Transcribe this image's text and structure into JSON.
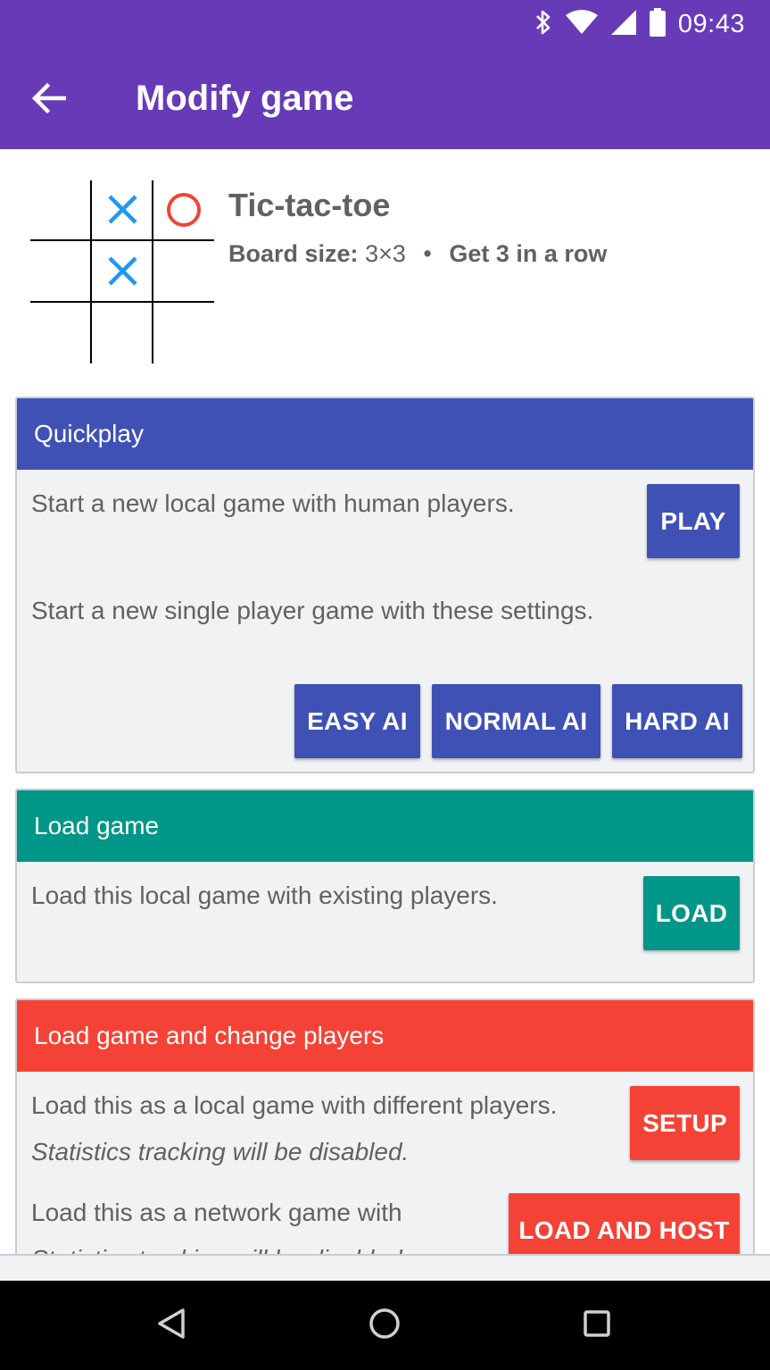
{
  "status_bar": {
    "time": "09:43",
    "icons": [
      "bluetooth-icon",
      "wifi-icon",
      "signal-icon",
      "battery-icon"
    ]
  },
  "app_bar": {
    "title": "Modify game",
    "back_icon": "arrow-back-icon"
  },
  "game": {
    "title": "Tic-tac-toe",
    "board_size_label": "Board size:",
    "board_size_value": "3×3",
    "separator": "•",
    "win_condition": "Get 3 in a row",
    "preview_marks": [
      {
        "row": 0,
        "col": 1,
        "mark": "X"
      },
      {
        "row": 0,
        "col": 2,
        "mark": "O"
      },
      {
        "row": 1,
        "col": 1,
        "mark": "X"
      }
    ]
  },
  "quickplay": {
    "header": "Quickplay",
    "human_text": "Start a new local game with human players.",
    "play_label": "PLAY",
    "single_text": "Start a new single player game with these settings.",
    "easy_label": "EASY AI",
    "normal_label": "NORMAL AI",
    "hard_label": "HARD AI"
  },
  "load_game": {
    "header": "Load game",
    "text": "Load this local game with existing players.",
    "load_label": "LOAD"
  },
  "change_players": {
    "header": "Load game and change players",
    "local_text": "Load this as a local game with different players.",
    "stats_note": "Statistics tracking will be disabled.",
    "setup_label": "SETUP",
    "network_text": "Load this as a network game with",
    "network_stats_note": "Statistics tracking will be disabled.",
    "host_label": "LOAD AND HOST"
  },
  "colors": {
    "app_bar": "#673ab7",
    "quickplay": "#3f51b5",
    "load_game": "#009688",
    "change_players": "#f44336",
    "mark_x": "#2196f3",
    "mark_o": "#f44336"
  },
  "nav_bar": {
    "icons": [
      "back-triangle-icon",
      "home-circle-icon",
      "recents-square-icon"
    ]
  }
}
